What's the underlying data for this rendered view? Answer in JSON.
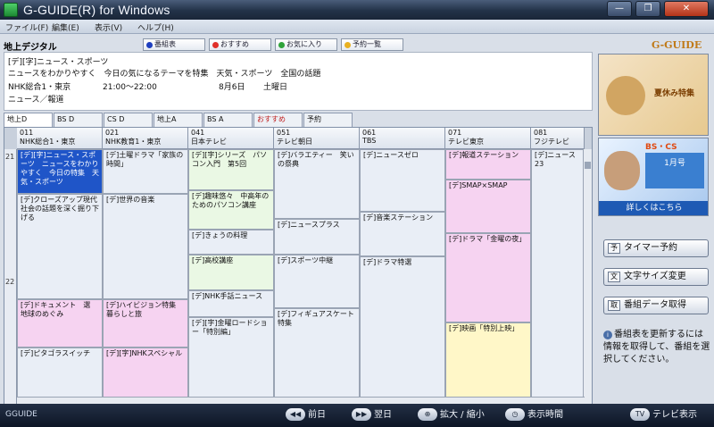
{
  "window": {
    "title": "G-GUIDE(R) for Windows",
    "buttons": [
      "—",
      "❐",
      "✕"
    ]
  },
  "menu": [
    "ファイル(F)",
    "編集(E)",
    "表示(V)",
    "ヘルプ(H)"
  ],
  "header": {
    "channel_type": "地上デジタル",
    "legend": [
      {
        "label": "番組表",
        "color": "#1e3fbf"
      },
      {
        "label": "おすすめ",
        "color": "#e0302a"
      },
      {
        "label": "お気に入り",
        "color": "#2fa33a"
      },
      {
        "label": "予約一覧",
        "color": "#e8b020"
      }
    ],
    "logo": "G-GUIDE"
  },
  "program_info": {
    "title": "[デ][字]ニュース・スポーツ",
    "description": "ニュースをわかりやすく　今日の気になるテーマを特集　天気・スポーツ　全国の話題",
    "channel": "NHK総合1・東京",
    "time": "21:00～22:00",
    "date": "8月6日",
    "weekday": "土曜日",
    "genre": "ニュース／報道"
  },
  "tabs": [
    "地上D",
    "BS D",
    "CS D",
    "地上A",
    "BS A",
    "おすすめ",
    "予約"
  ],
  "grid": {
    "columns": [
      {
        "num": "011",
        "name": "NHK総合1・東京"
      },
      {
        "num": "021",
        "name": "NHK教育1・東京"
      },
      {
        "num": "041",
        "name": "日本テレビ"
      },
      {
        "num": "051",
        "name": "テレビ朝日"
      },
      {
        "num": "061",
        "name": "TBS"
      },
      {
        "num": "071",
        "name": "テレビ東京"
      },
      {
        "num": "081",
        "name": "フジテレビ"
      }
    ],
    "times": [
      "21",
      "22"
    ],
    "cells": [
      {
        "text": "[デ][字]ニュース・スポーツ　ニュースをわかりやすく　今日の特集　天気・スポーツ",
        "color": "#1f55c8"
      },
      {
        "text": "[デ]クローズアップ現代　社会の話題を深く掘り下げる",
        "color": "#e9eef6"
      },
      {
        "text": "[デ]土曜ドラマ「家族の時間」",
        "color": "#e9eef6"
      },
      {
        "text": "[デ]ドキュメント　選　地球のめぐみ",
        "color": "#f6d3f1"
      },
      {
        "text": "[デ]ハイビジョン特集　暮らしと旅",
        "color": "#f6d3f1"
      },
      {
        "text": "[デ][字]NHKスペシャル",
        "color": "#f6d3f1"
      },
      {
        "text": "[デ]世界の音楽",
        "color": "#e9eef6"
      },
      {
        "text": "[デ]ピタゴラスイッチ",
        "color": "#e9eef6"
      },
      {
        "text": "[デ][字]シリーズ　パソコン入門　第5回",
        "color": "#eaf8e4"
      },
      {
        "text": "[デ]趣味悠々　中高年のためのパソコン講座",
        "color": "#eaf8e4"
      },
      {
        "text": "[デ]きょうの料理",
        "color": "#e9eef6"
      },
      {
        "text": "[デ]高校講座",
        "color": "#eaf8e4"
      },
      {
        "text": "[デ]NHK手話ニュース",
        "color": "#e9eef6"
      },
      {
        "text": "[デ][字]金曜ロードショー「特別編」",
        "color": "#e9eef6"
      },
      {
        "text": "[デ]バラエティー　笑いの祭典",
        "color": "#e9eef6"
      },
      {
        "text": "[デ]ニュースプラス",
        "color": "#e9eef6"
      },
      {
        "text": "[デ]スポーツ中継",
        "color": "#e9eef6"
      },
      {
        "text": "[デ]フィギュアスケート特集",
        "color": "#e9eef6"
      },
      {
        "text": "[デ]ニュースゼロ",
        "color": "#e9eef6"
      },
      {
        "text": "[デ]音楽ステーション",
        "color": "#e9eef6"
      },
      {
        "text": "[デ]ドラマ特選",
        "color": "#e9eef6"
      },
      {
        "text": "[デ]報道ステーション",
        "color": "#f6d3f1"
      },
      {
        "text": "[デ]SMAP×SMAP",
        "color": "#f6d3f1"
      },
      {
        "text": "[デ]ドラマ「金曜の夜」",
        "color": "#f6d3f1"
      },
      {
        "text": "[デ]映画「特別上映」",
        "color": "#fff7c8"
      },
      {
        "text": "[デ]ニュース23",
        "color": "#e9eef6"
      }
    ]
  },
  "side": {
    "ad1": "夏休み特集",
    "ad2": "BS・CS",
    "ad2_banner": "1月号",
    "ad2_strip": "詳しくはこちら",
    "buttons": [
      {
        "label": "タイマー予約",
        "icon": "予"
      },
      {
        "label": "文字サイズ変更",
        "icon": "文"
      },
      {
        "label": "番組データ取得",
        "icon": "取"
      }
    ],
    "note": "番組表を更新するには情報を取得して、番組を選択してください。"
  },
  "status": {
    "left": "GGUIDE",
    "prev_label": "前日",
    "next_label": "翌日",
    "zoom_label": "拡大 / 縮小",
    "display_label": "表示時間",
    "tv_label": "テレビ表示"
  }
}
